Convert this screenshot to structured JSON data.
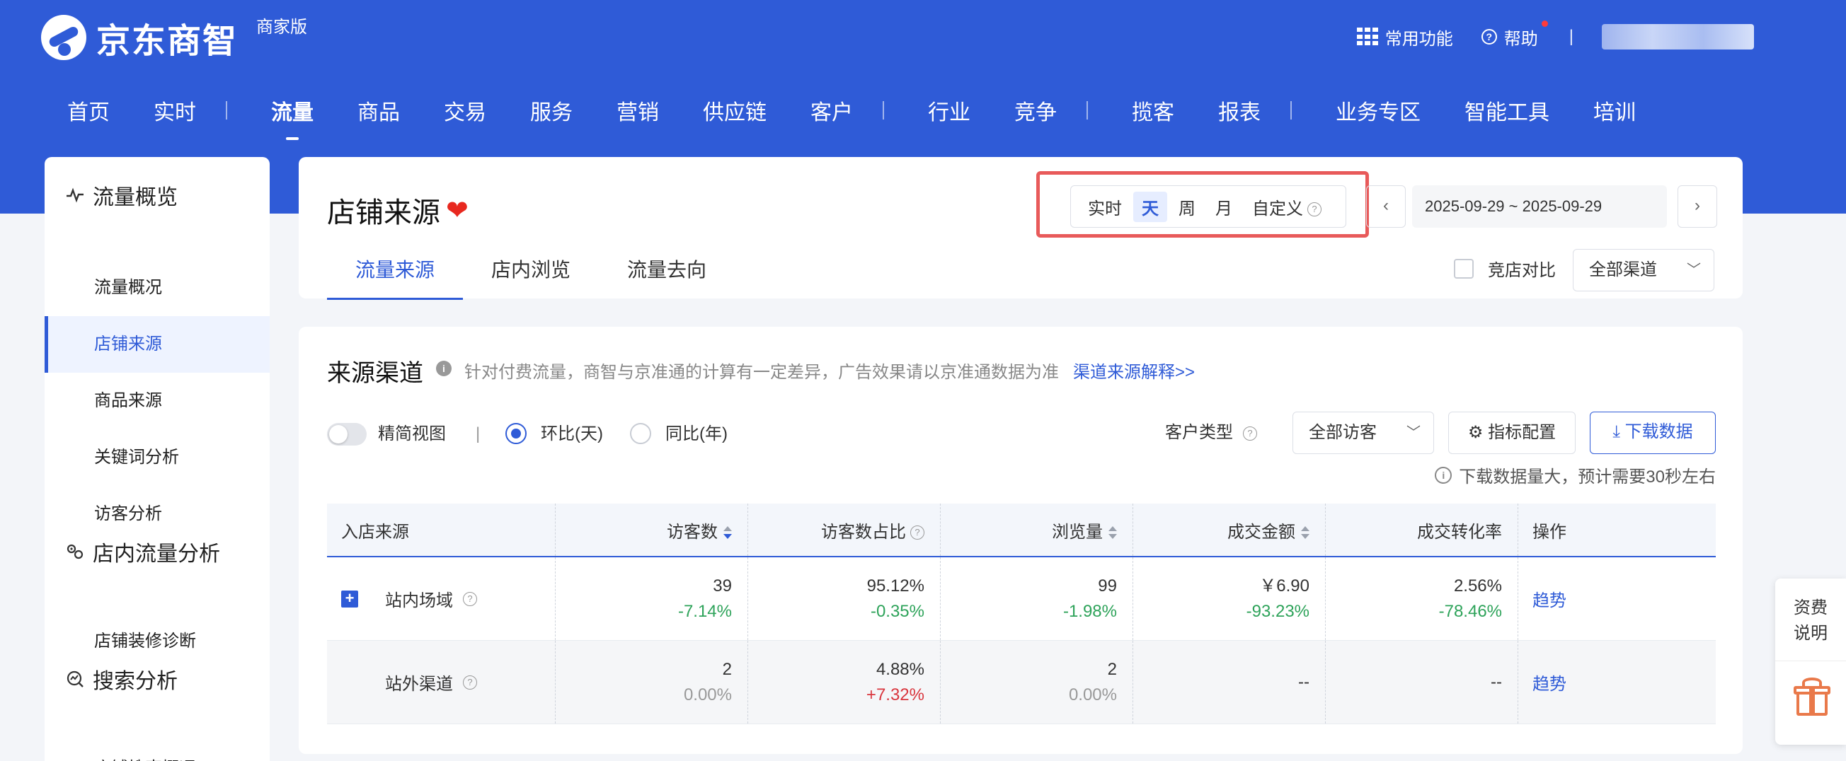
{
  "header": {
    "logo_text": "京东商智",
    "edition_badge": "商家版",
    "common_functions": "常用功能",
    "help": "帮助",
    "separator": "|",
    "nav": [
      "首页",
      "实时",
      "流量",
      "商品",
      "交易",
      "服务",
      "营销",
      "供应链",
      "客户",
      "行业",
      "竞争",
      "揽客",
      "报表",
      "业务专区",
      "智能工具",
      "培训"
    ],
    "nav_active": "流量"
  },
  "sidebar": {
    "group1_title": "流量概览",
    "group1_items": [
      "流量概况",
      "店铺来源",
      "商品来源",
      "关键词分析",
      "访客分析"
    ],
    "active_item": "店铺来源",
    "group2_title": "店内流量分析",
    "group2_items": [
      "店铺装修诊断"
    ],
    "group3_title": "搜索分析",
    "group3_items": [
      "店铺搜索概况"
    ]
  },
  "page": {
    "title": "店铺来源",
    "tabs": [
      "流量来源",
      "店内浏览",
      "流量去向"
    ],
    "active_tab": "流量来源",
    "period_options": [
      "实时",
      "天",
      "周",
      "月",
      "自定义"
    ],
    "active_period": "天",
    "prev_arrow": "‹",
    "next_arrow": "›",
    "date_range": "2025-09-29 ~ 2025-09-29",
    "compare_label": "竞店对比",
    "channel_select": "全部渠道"
  },
  "source_section": {
    "title": "来源渠道",
    "note": "针对付费流量，商智与京准通的计算有一定差异，广告效果请以京准通数据为准",
    "link": "渠道来源解释>>",
    "simple_view_label": "精简视图",
    "divider": "|",
    "radio_mom": "环比(天)",
    "radio_yoy": "同比(年)",
    "customer_type_label": "客户类型",
    "visitor_select": "全部访客",
    "metric_config": "指标配置",
    "download": "下载数据",
    "download_note": "下载数据量大，预计需要30秒左右"
  },
  "table": {
    "headers": [
      "入店来源",
      "访客数",
      "访客数占比",
      "浏览量",
      "成交金额",
      "成交转化率",
      "操作"
    ],
    "rows": [
      {
        "source": "站内场域",
        "visitors": "39",
        "visitors_delta": "-7.14%",
        "share": "95.12%",
        "share_delta": "-0.35%",
        "pv": "99",
        "pv_delta": "-1.98%",
        "amount": "￥6.90",
        "amount_delta": "-93.23%",
        "conv": "2.56%",
        "conv_delta": "-78.46%",
        "action": "趋势"
      },
      {
        "source": "站外渠道",
        "visitors": "2",
        "visitors_delta": "0.00%",
        "share": "4.88%",
        "share_delta": "+7.32%",
        "pv": "2",
        "pv_delta": "0.00%",
        "amount": "--",
        "conv": "--",
        "action": "趋势"
      }
    ]
  },
  "float_panel": {
    "fee_text_line1": "资费",
    "fee_text_line2": "说明"
  },
  "colors": {
    "brand_blue": "#2f5bd7",
    "highlight_red": "#e85a5a",
    "positive_green": "#2ea35a",
    "negative_red": "#d9363e"
  }
}
